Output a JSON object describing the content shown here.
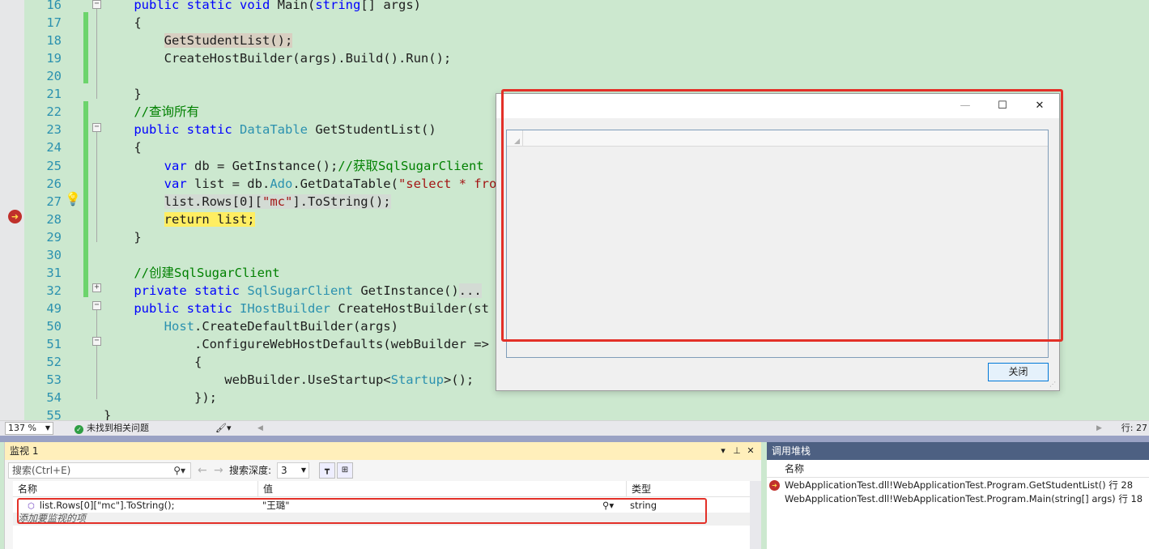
{
  "editor": {
    "lines": [
      {
        "num": "16",
        "tokens": [
          {
            "t": "    ",
            "c": "pl"
          },
          {
            "t": "public",
            "c": "kw"
          },
          {
            "t": " ",
            "c": "pl"
          },
          {
            "t": "static",
            "c": "kw"
          },
          {
            "t": " ",
            "c": "pl"
          },
          {
            "t": "void",
            "c": "kw"
          },
          {
            "t": " Main(",
            "c": "pl"
          },
          {
            "t": "string",
            "c": "kw"
          },
          {
            "t": "[] args)",
            "c": "pl"
          }
        ]
      },
      {
        "num": "17",
        "tokens": [
          {
            "t": "    {",
            "c": "pl"
          }
        ]
      },
      {
        "num": "18",
        "tokens": [
          {
            "t": "        ",
            "c": "pl"
          },
          {
            "t": "GetStudentList();",
            "c": "pl",
            "hl": "hl-ref"
          }
        ]
      },
      {
        "num": "19",
        "tokens": [
          {
            "t": "        CreateHostBuilder(args).Build().Run();",
            "c": "pl"
          }
        ]
      },
      {
        "num": "20",
        "tokens": []
      },
      {
        "num": "21",
        "tokens": [
          {
            "t": "    }",
            "c": "pl"
          }
        ]
      },
      {
        "num": "22",
        "tokens": [
          {
            "t": "    ",
            "c": "pl"
          },
          {
            "t": "//查询所有",
            "c": "cm"
          }
        ]
      },
      {
        "num": "23",
        "tokens": [
          {
            "t": "    ",
            "c": "pl"
          },
          {
            "t": "public",
            "c": "kw"
          },
          {
            "t": " ",
            "c": "pl"
          },
          {
            "t": "static",
            "c": "kw"
          },
          {
            "t": " ",
            "c": "pl"
          },
          {
            "t": "DataTable",
            "c": "ty"
          },
          {
            "t": " GetStudentList()",
            "c": "pl"
          }
        ]
      },
      {
        "num": "24",
        "tokens": [
          {
            "t": "    {",
            "c": "pl"
          }
        ]
      },
      {
        "num": "25",
        "tokens": [
          {
            "t": "        ",
            "c": "pl"
          },
          {
            "t": "var",
            "c": "kw"
          },
          {
            "t": " db = GetInstance();",
            "c": "pl"
          },
          {
            "t": "//获取SqlSugarClient",
            "c": "cm"
          }
        ]
      },
      {
        "num": "26",
        "tokens": [
          {
            "t": "        ",
            "c": "pl"
          },
          {
            "t": "var",
            "c": "kw"
          },
          {
            "t": " list = db.",
            "c": "pl"
          },
          {
            "t": "Ado",
            "c": "ty"
          },
          {
            "t": ".GetDataTable(",
            "c": "pl"
          },
          {
            "t": "\"select * from",
            "c": "st"
          }
        ]
      },
      {
        "num": "27",
        "tokens": [
          {
            "t": "        ",
            "c": "pl"
          },
          {
            "t": "list.Rows[0][",
            "c": "pl",
            "hl": "hl-sel"
          },
          {
            "t": "\"mc\"",
            "c": "st",
            "hl": "hl-sel"
          },
          {
            "t": "].ToString();",
            "c": "pl",
            "hl": "hl-sel"
          }
        ]
      },
      {
        "num": "28",
        "tokens": [
          {
            "t": "        ",
            "c": "pl"
          },
          {
            "t": "return list;",
            "c": "pl",
            "hl": "hl-cur"
          }
        ]
      },
      {
        "num": "29",
        "tokens": [
          {
            "t": "    }",
            "c": "pl"
          }
        ]
      },
      {
        "num": "30",
        "tokens": []
      },
      {
        "num": "31",
        "tokens": [
          {
            "t": "    ",
            "c": "pl"
          },
          {
            "t": "//创建SqlSugarClient",
            "c": "cm"
          }
        ]
      },
      {
        "num": "32",
        "tokens": [
          {
            "t": "    ",
            "c": "pl"
          },
          {
            "t": "private",
            "c": "kw"
          },
          {
            "t": " ",
            "c": "pl"
          },
          {
            "t": "static",
            "c": "kw"
          },
          {
            "t": " ",
            "c": "pl"
          },
          {
            "t": "SqlSugarClient",
            "c": "ty"
          },
          {
            "t": " GetInstance()",
            "c": "pl"
          },
          {
            "t": "...",
            "c": "pl",
            "hl": "hl-sel"
          }
        ]
      },
      {
        "num": "49",
        "tokens": [
          {
            "t": "    ",
            "c": "pl"
          },
          {
            "t": "public",
            "c": "kw"
          },
          {
            "t": " ",
            "c": "pl"
          },
          {
            "t": "static",
            "c": "kw"
          },
          {
            "t": " ",
            "c": "pl"
          },
          {
            "t": "IHostBuilder",
            "c": "ty"
          },
          {
            "t": " CreateHostBuilder(st",
            "c": "pl"
          }
        ]
      },
      {
        "num": "50",
        "tokens": [
          {
            "t": "        ",
            "c": "pl"
          },
          {
            "t": "Host",
            "c": "ty"
          },
          {
            "t": ".CreateDefaultBuilder(args)",
            "c": "pl"
          }
        ]
      },
      {
        "num": "51",
        "tokens": [
          {
            "t": "            .ConfigureWebHostDefaults(webBuilder =>",
            "c": "pl"
          }
        ]
      },
      {
        "num": "52",
        "tokens": [
          {
            "t": "            {",
            "c": "pl"
          }
        ]
      },
      {
        "num": "53",
        "tokens": [
          {
            "t": "                webBuilder.UseStartup<",
            "c": "pl"
          },
          {
            "t": "Startup",
            "c": "ty"
          },
          {
            "t": ">();",
            "c": "pl"
          }
        ]
      },
      {
        "num": "54",
        "tokens": [
          {
            "t": "            });",
            "c": "pl"
          }
        ]
      },
      {
        "num": "55",
        "tokens": [
          {
            "t": "}",
            "c": "pl"
          }
        ]
      }
    ]
  },
  "statusbar": {
    "zoom": "137 %",
    "issues": "未找到相关问题",
    "row": "行: 27"
  },
  "watch": {
    "title": "监视 1",
    "search_placeholder": "搜索(Ctrl+E)",
    "depth_label": "搜索深度:",
    "depth_value": "3",
    "columns": [
      "名称",
      "值",
      "类型"
    ],
    "row": {
      "name": "list.Rows[0][\"mc\"].ToString();",
      "value": "\"王璐\"",
      "type": "string"
    },
    "add_hint": "添加要监视的项"
  },
  "callstack": {
    "title": "调用堆栈",
    "column": "名称",
    "frames": [
      "WebApplicationTest.dll!WebApplicationTest.Program.GetStudentList() 行 28",
      "WebApplicationTest.dll!WebApplicationTest.Program.Main(string[] args) 行 18"
    ]
  },
  "dialog": {
    "close_label": "关闭"
  },
  "colors": {
    "editor_bg": "#cce8cf",
    "annotation_red": "#e33028",
    "watch_title_bg": "#ffefbb",
    "callstack_title_bg": "#4d6082"
  }
}
